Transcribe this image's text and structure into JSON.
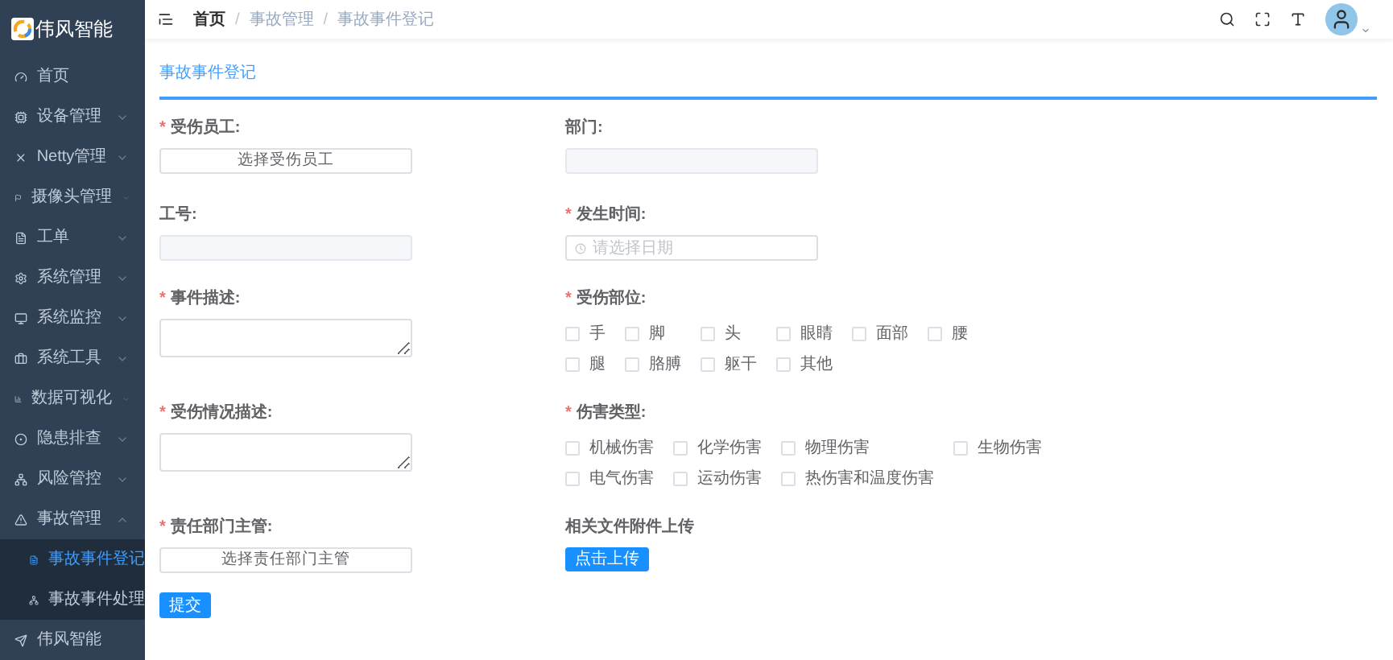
{
  "sidebar": {
    "logo": "伟风智能",
    "items": [
      {
        "label": "首页"
      },
      {
        "label": "设备管理",
        "expanded": false
      },
      {
        "label": "Netty管理",
        "expanded": false
      },
      {
        "label": "摄像头管理",
        "expanded": false
      },
      {
        "label": "工单",
        "expanded": false
      },
      {
        "label": "系统管理",
        "expanded": false
      },
      {
        "label": "系统监控",
        "expanded": false
      },
      {
        "label": "系统工具",
        "expanded": false
      },
      {
        "label": "数据可视化",
        "expanded": false
      },
      {
        "label": "隐患排查",
        "expanded": false
      },
      {
        "label": "风险管控",
        "expanded": false
      },
      {
        "label": "事故管理",
        "expanded": true,
        "children": [
          {
            "label": "事故事件登记",
            "selected": true
          },
          {
            "label": "事故事件处理",
            "selected": false
          }
        ]
      },
      {
        "label": "伟风智能"
      }
    ]
  },
  "breadcrumb": [
    {
      "label": "首页"
    },
    {
      "separator": "/",
      "label": "事故管理"
    },
    {
      "separator": "/",
      "label": "事故事件登记"
    }
  ],
  "card_title": "事故事件登记",
  "fields": {
    "employee": {
      "label": "受伤员工:",
      "required_mark": "*",
      "button": "选择受伤员工"
    },
    "department": {
      "label": "部门:"
    },
    "number": {
      "label": "工号:"
    },
    "time": {
      "label": "发生时间:",
      "required_mark": "*",
      "placeholder": "请选择日期"
    },
    "description": {
      "label": "事件描述:",
      "required_mark": "*"
    },
    "body_parts": {
      "label": "受伤部位:",
      "required_mark": "*",
      "options": [
        {
          "label": "手",
          "checked": false
        },
        {
          "label": "脚",
          "checked": false
        },
        {
          "label": "头",
          "checked": false
        },
        {
          "label": "眼睛",
          "checked": false
        },
        {
          "label": "面部",
          "checked": false
        },
        {
          "label": "腰",
          "checked": false
        },
        {
          "label": "腿",
          "checked": false
        },
        {
          "label": "胳膊",
          "checked": false
        },
        {
          "label": "躯干",
          "checked": false
        },
        {
          "label": "其他",
          "checked": false
        }
      ]
    },
    "injury_description": {
      "label": "受伤情况描述:",
      "required_mark": "*"
    },
    "injury_types": {
      "label": "伤害类型:",
      "required_mark": "*",
      "options": [
        {
          "label": "机械伤害",
          "checked": false
        },
        {
          "label": "化学伤害",
          "checked": false
        },
        {
          "label": "物理伤害",
          "checked": false
        },
        {
          "label": "生物伤害",
          "checked": false
        },
        {
          "label": "电气伤害",
          "checked": false
        },
        {
          "label": "运动伤害",
          "checked": false
        },
        {
          "label": "热伤害和温度伤害",
          "checked": false
        }
      ]
    },
    "manager": {
      "label": "责任部门主管:",
      "required_mark": "*",
      "button": "选择责任部门主管"
    },
    "attachment": {
      "label": "相关文件附件上传",
      "button": "点击上传"
    }
  },
  "submit": "提交"
}
